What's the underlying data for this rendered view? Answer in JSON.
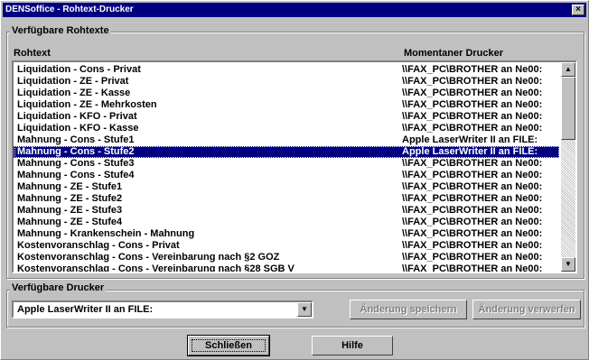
{
  "window": {
    "title": "DENSoffice - Rohtext-Drucker",
    "close_glyph": "×"
  },
  "group_rohtexte": {
    "title": "Verfügbare Rohtexte"
  },
  "list": {
    "header_col1": "Rohtext",
    "header_col2": "Momentaner Drucker",
    "rows": [
      [
        "Liquidation - Cons - Privat",
        "\\\\FAX_PC\\BROTHER an Ne00:"
      ],
      [
        "Liquidation - ZE - Privat",
        "\\\\FAX_PC\\BROTHER an Ne00:"
      ],
      [
        "Liquidation - ZE - Kasse",
        "\\\\FAX_PC\\BROTHER an Ne00:"
      ],
      [
        "Liquidation - ZE - Mehrkosten",
        "\\\\FAX_PC\\BROTHER an Ne00:"
      ],
      [
        "Liquidation - KFO - Privat",
        "\\\\FAX_PC\\BROTHER an Ne00:"
      ],
      [
        "Liquidation - KFO - Kasse",
        "\\\\FAX_PC\\BROTHER an Ne00:"
      ],
      [
        "Mahnung - Cons - Stufe1",
        "Apple LaserWriter II an FILE:"
      ],
      [
        "Mahnung - Cons - Stufe2",
        "Apple LaserWriter II an FILE:"
      ],
      [
        "Mahnung - Cons - Stufe3",
        "\\\\FAX_PC\\BROTHER an Ne00:"
      ],
      [
        "Mahnung - Cons - Stufe4",
        "\\\\FAX_PC\\BROTHER an Ne00:"
      ],
      [
        "Mahnung - ZE - Stufe1",
        "\\\\FAX_PC\\BROTHER an Ne00:"
      ],
      [
        "Mahnung - ZE - Stufe2",
        "\\\\FAX_PC\\BROTHER an Ne00:"
      ],
      [
        "Mahnung - ZE - Stufe3",
        "\\\\FAX_PC\\BROTHER an Ne00:"
      ],
      [
        "Mahnung - ZE - Stufe4",
        "\\\\FAX_PC\\BROTHER an Ne00:"
      ],
      [
        "Mahnung - Krankenschein - Mahnung",
        "\\\\FAX_PC\\BROTHER an Ne00:"
      ],
      [
        "Kostenvoranschlag - Cons - Privat",
        "\\\\FAX_PC\\BROTHER an Ne00:"
      ],
      [
        "Kostenvoranschlag - Cons - Vereinbarung nach §2 GOZ",
        "\\\\FAX_PC\\BROTHER an Ne00:"
      ],
      [
        "Kostenvoranschlag - Cons - Vereinbarung nach §28 SGB V",
        "\\\\FAX_PC\\BROTHER an Ne00:"
      ]
    ],
    "selected_index": 7,
    "scroll_up": "▲",
    "scroll_down": "▼"
  },
  "group_drucker": {
    "title": "Verfügbare Drucker"
  },
  "printer_combo": {
    "value": "Apple LaserWriter II an FILE:",
    "arrow": "▼"
  },
  "buttons": {
    "save": "Änderung speichern",
    "discard": "Änderung verwerfen",
    "close": "Schließen",
    "help": "Hilfe"
  }
}
